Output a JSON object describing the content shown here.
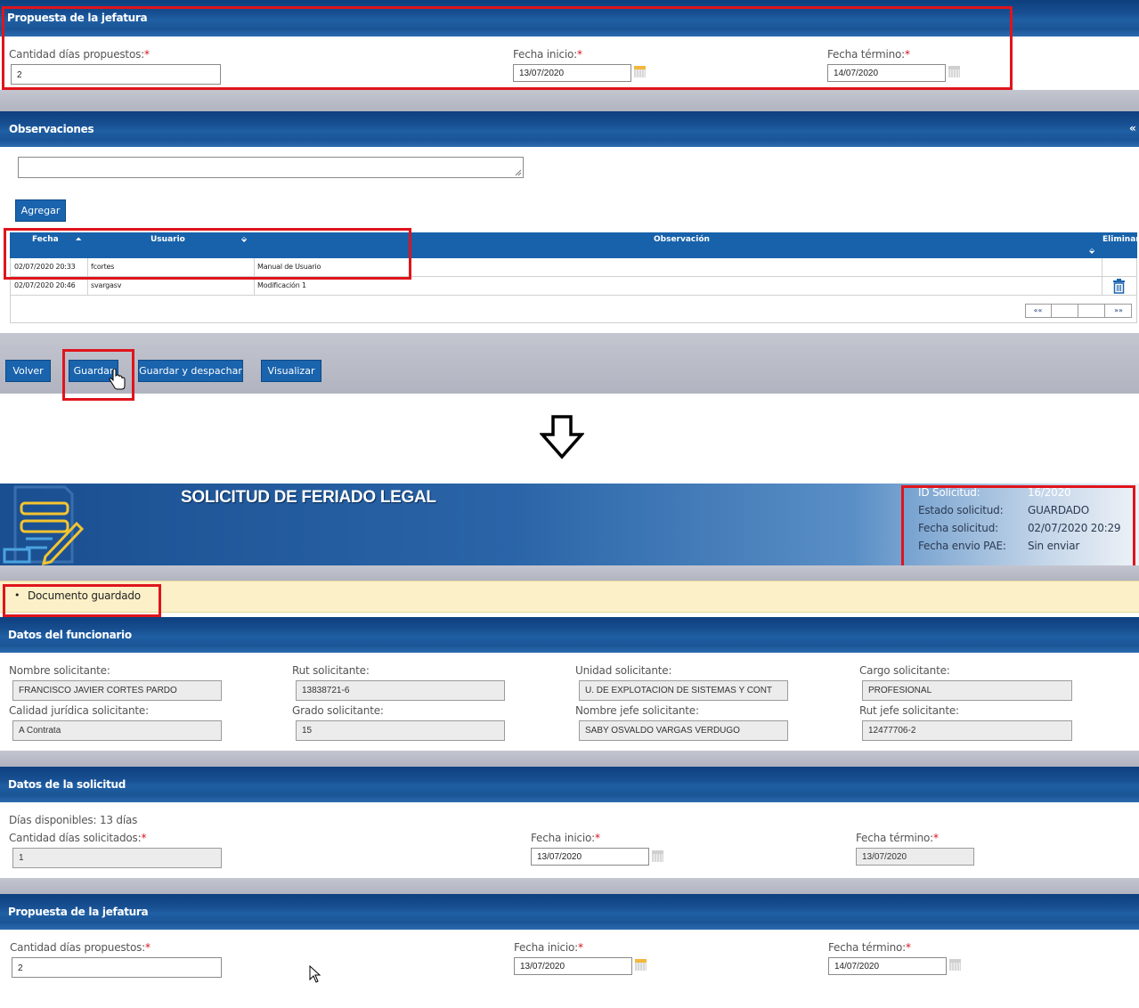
{
  "top": {
    "propuesta": {
      "title": "Propuesta de la jefatura",
      "cantidad_label": "Cantidad días propuestos:",
      "cantidad_value": "2",
      "fecha_inicio_label": "Fecha inicio:",
      "fecha_inicio_value": "13/07/2020",
      "fecha_termino_label": "Fecha término:",
      "fecha_termino_value": "14/07/2020",
      "required_mark": "*"
    },
    "observaciones": {
      "title": "Observaciones",
      "collapse_glyph": "«",
      "agregar_label": "Agregar",
      "columns": {
        "fecha": "Fecha",
        "usuario": "Usuario",
        "observacion": "Observación",
        "eliminar": "Eliminar"
      },
      "rows": [
        {
          "fecha": "02/07/2020 20:33",
          "usuario": "fcortes",
          "observacion": "Manual de Usuario"
        },
        {
          "fecha": "02/07/2020 20:46",
          "usuario": "svargasv",
          "observacion": "Modificación 1"
        }
      ],
      "pager": {
        "first": "««",
        "last": "»»"
      }
    },
    "actions": {
      "volver": "Volver",
      "guardar": "Guardar",
      "guardar_despachar": "Guardar y despachar",
      "visualizar": "Visualizar"
    }
  },
  "bottom": {
    "header": {
      "title": "SOLICITUD DE FERIADO LEGAL",
      "info": [
        {
          "label": "ID Solicitud:",
          "value": "16/2020"
        },
        {
          "label": "Estado solicitud:",
          "value": "GUARDADO"
        },
        {
          "label": "Fecha solicitud:",
          "value": "02/07/2020 20:29"
        },
        {
          "label": "Fecha envio PAE:",
          "value": "Sin enviar"
        }
      ]
    },
    "message": "Documento guardado",
    "funcionario": {
      "title": "Datos del funcionario",
      "fields": [
        {
          "label": "Nombre solicitante:",
          "value": "FRANCISCO JAVIER CORTES PARDO"
        },
        {
          "label": "Rut solicitante:",
          "value": "13838721-6"
        },
        {
          "label": "Unidad solicitante:",
          "value": "U. DE EXPLOTACION DE SISTEMAS Y CONT"
        },
        {
          "label": "Cargo solicitante:",
          "value": "PROFESIONAL"
        },
        {
          "label": "Calidad jurídica solicitante:",
          "value": "A Contrata"
        },
        {
          "label": "Grado solicitante:",
          "value": "15"
        },
        {
          "label": "Nombre jefe solicitante:",
          "value": "SABY OSVALDO VARGAS VERDUGO"
        },
        {
          "label": "Rut jefe solicitante:",
          "value": "12477706-2"
        }
      ]
    },
    "solicitud": {
      "title": "Datos de la solicitud",
      "dias_disponibles": "Días disponibles: 13 días",
      "cantidad_label": "Cantidad días solicitados:",
      "cantidad_value": "1",
      "fecha_inicio_label": "Fecha inicio:",
      "fecha_inicio_value": "13/07/2020",
      "fecha_termino_label": "Fecha término:",
      "fecha_termino_value": "13/07/2020"
    },
    "propuesta": {
      "title": "Propuesta de la jefatura",
      "cantidad_label": "Cantidad días propuestos:",
      "cantidad_value": "2",
      "fecha_inicio_label": "Fecha inicio:",
      "fecha_inicio_value": "13/07/2020",
      "fecha_termino_label": "Fecha término:",
      "fecha_termino_value": "14/07/2020"
    }
  },
  "colors": {
    "bar_blue": "#1a5596",
    "button_blue": "#1a63ad",
    "highlight_red": "#e0141c",
    "message_bg": "#fcf0c8",
    "required": "#d2141c"
  }
}
